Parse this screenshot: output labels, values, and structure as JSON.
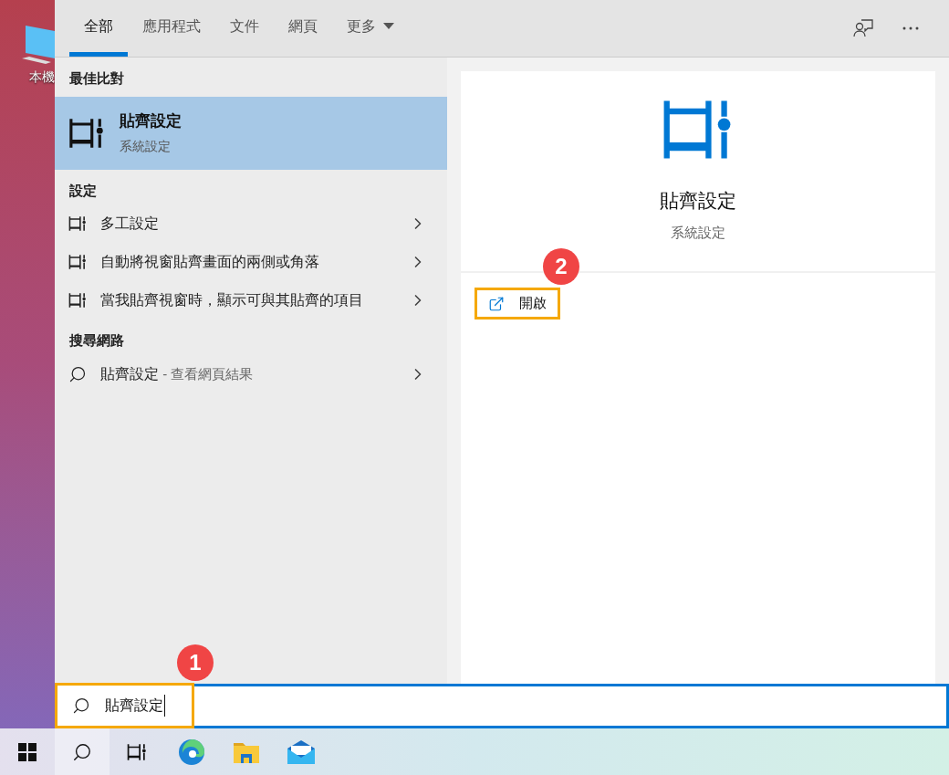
{
  "desktop": {
    "icon_label": "本機"
  },
  "tabs": [
    {
      "label": "全部",
      "selected": true,
      "kind": "tab"
    },
    {
      "label": "應用程式",
      "selected": false,
      "kind": "tab"
    },
    {
      "label": "文件",
      "selected": false,
      "kind": "tab"
    },
    {
      "label": "網頁",
      "selected": false,
      "kind": "tab"
    },
    {
      "label": "更多",
      "selected": false,
      "kind": "dropdown"
    }
  ],
  "best_match": {
    "heading": "最佳比對",
    "title": "貼齊設定",
    "subtitle": "系統設定",
    "selected": true
  },
  "sections": [
    {
      "heading": "設定",
      "items": [
        {
          "kind": "setting",
          "label": "多工設定"
        },
        {
          "kind": "setting",
          "label": "自動將視窗貼齊畫面的兩側或角落"
        },
        {
          "kind": "setting",
          "label": "當我貼齊視窗時，顯示可與其貼齊的項目"
        }
      ]
    },
    {
      "heading": "搜尋網路",
      "items": [
        {
          "kind": "web",
          "label": "貼齊設定",
          "hint": "- 查看網頁結果"
        }
      ]
    }
  ],
  "preview": {
    "title": "貼齊設定",
    "subtitle": "系統設定",
    "actions": [
      {
        "label": "開啟",
        "annotation": "2"
      }
    ]
  },
  "search": {
    "value": "貼齊設定",
    "annotation": "1"
  }
}
